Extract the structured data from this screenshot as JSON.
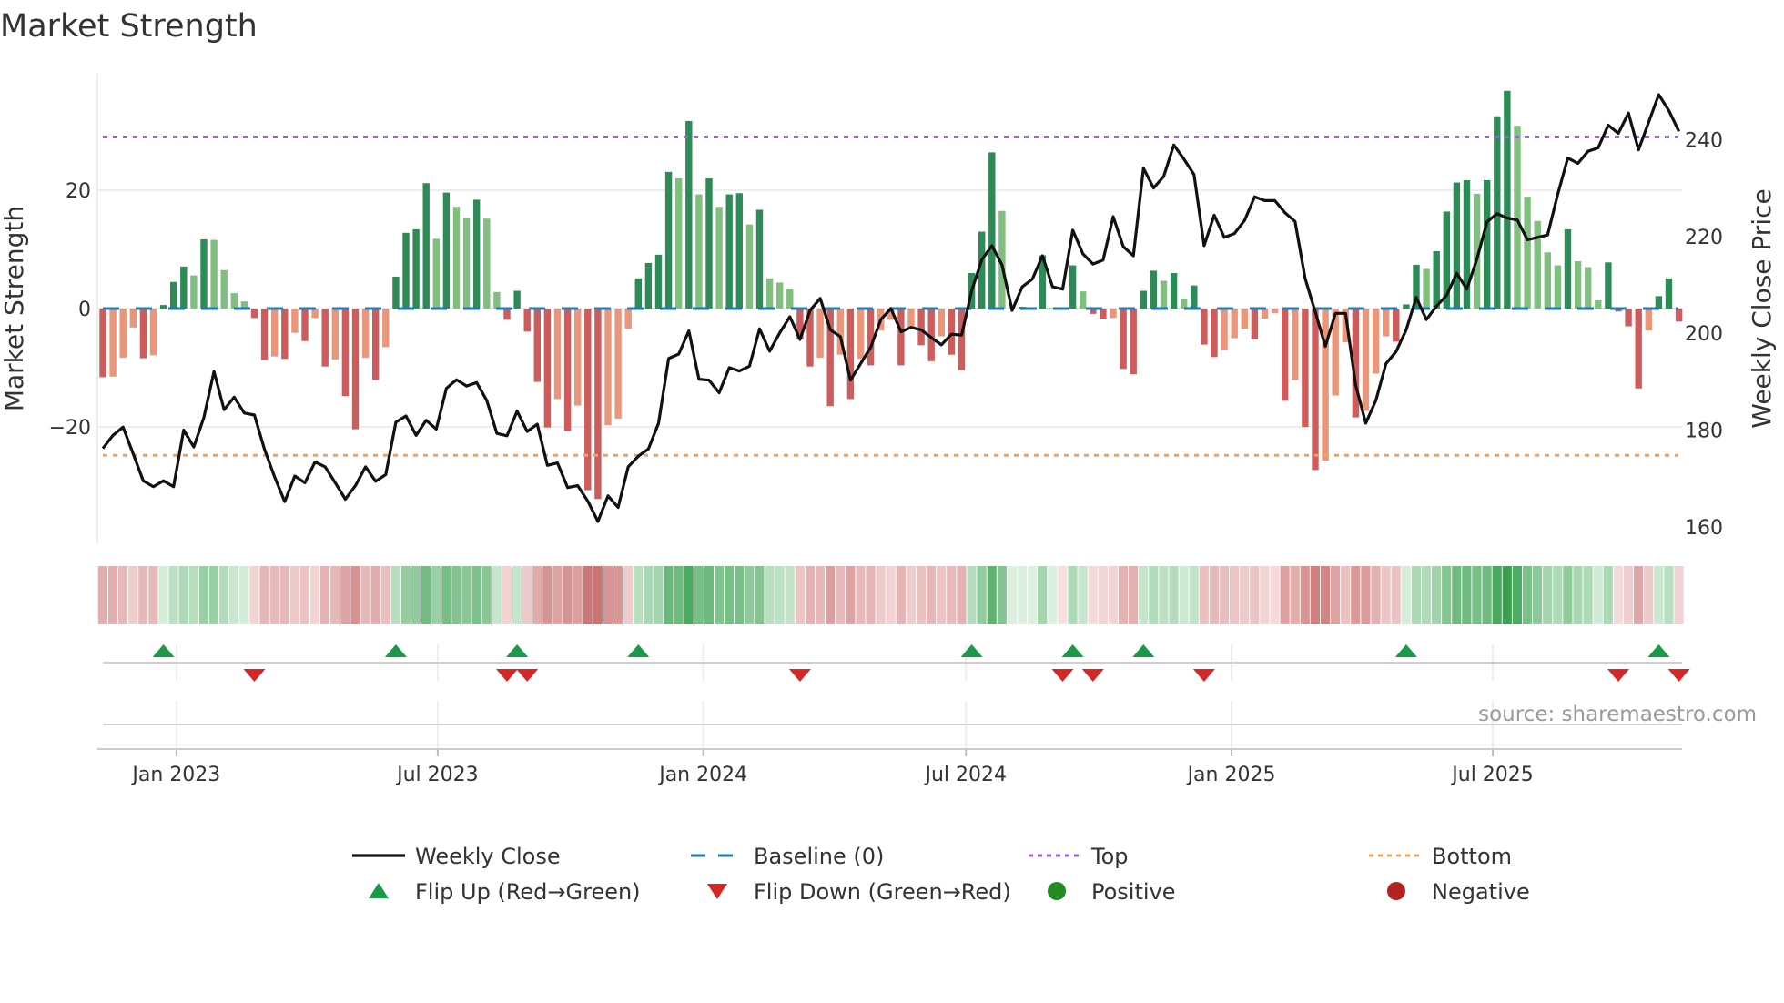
{
  "title": "Market Strength",
  "source_note": "source: sharemaestro.com",
  "colors": {
    "bar_green_dark": "#2e8b57",
    "bar_green_light": "#80bf80",
    "bar_red_dark": "#cd5c5c",
    "bar_red_light": "#e9967a",
    "price_line": "#111111",
    "baseline": "#1f77b4",
    "top": "#9b5fd6",
    "bottom": "#f0a35e",
    "flip_up": "#1a9a46",
    "flip_down": "#d62728",
    "positive": "#228b22",
    "negative": "#b22222"
  },
  "chart_data": {
    "type": "bar",
    "title": "Market Strength",
    "x_start": "2022-11-11",
    "x_step_days": 7,
    "x_ticks": [
      {
        "date": "2023-01-01",
        "label": "Jan 2023"
      },
      {
        "date": "2023-07-01",
        "label": "Jul 2023"
      },
      {
        "date": "2024-01-01",
        "label": "Jan 2024"
      },
      {
        "date": "2024-07-01",
        "label": "Jul 2024"
      },
      {
        "date": "2025-01-01",
        "label": "Jan 2025"
      },
      {
        "date": "2025-07-01",
        "label": "Jul 2025"
      }
    ],
    "ylabel_left": "Market Strength",
    "ylim_left": [
      -40,
      40
    ],
    "yticks_left": [
      {
        "v": 20,
        "label": "20"
      },
      {
        "v": 0,
        "label": "0"
      },
      {
        "v": -20,
        "label": "−20"
      }
    ],
    "ylabel_right": "Weekly Close Price",
    "ylim_right": [
      156.2,
      254
    ],
    "yticks_right": [
      {
        "v": 240,
        "label": "240"
      },
      {
        "v": 220,
        "label": "220"
      },
      {
        "v": 200,
        "label": "200"
      },
      {
        "v": 180,
        "label": "180"
      },
      {
        "v": 160,
        "label": "160"
      }
    ],
    "top_level": 29,
    "bottom_level": -24.8,
    "baseline": 0,
    "grid": true,
    "legend_position": "bottom",
    "series": [
      {
        "name": "Market Strength",
        "type": "bar",
        "values": [
          -11.6,
          -11.5,
          -8.3,
          -3.2,
          -8.4,
          -7.9,
          0.6,
          4.5,
          7.1,
          5.6,
          11.7,
          11.6,
          6.5,
          2.6,
          1.2,
          -1.6,
          -8.7,
          -8.1,
          -8.5,
          -4.1,
          -5.5,
          -1.6,
          -9.8,
          -8.6,
          -14.8,
          -20.4,
          -8.3,
          -12.1,
          -6.5,
          5.4,
          12.8,
          13.4,
          21.2,
          11.8,
          19.6,
          17.2,
          15.3,
          18.4,
          15.2,
          2.8,
          -1.9,
          3.0,
          -3.9,
          -12.4,
          -20.1,
          -15.3,
          -20.7,
          -16.4,
          -30.7,
          -32.2,
          -19.7,
          -18.6,
          -3.4,
          5.1,
          7.7,
          9.1,
          23.1,
          22.0,
          31.7,
          19.3,
          22.0,
          17.2,
          19.3,
          19.5,
          14.2,
          16.7,
          5.1,
          4.4,
          3.4,
          -5.2,
          -9.8,
          -8.3,
          -16.5,
          -7.8,
          -15.3,
          -8.5,
          -9.6,
          -3.7,
          -1.9,
          -9.6,
          -3.1,
          -6.2,
          -8.9,
          -4.7,
          -7.8,
          -10.4,
          6.0,
          13.0,
          26.4,
          16.5,
          0.1,
          0.3,
          0.1,
          9.0,
          0.1,
          -0.1,
          7.3,
          2.9,
          -0.9,
          -1.7,
          -1.6,
          -10.2,
          -11.1,
          3.0,
          6.4,
          4.7,
          6.0,
          1.7,
          3.9,
          -6.1,
          -8.2,
          -7.0,
          -5.0,
          -3.4,
          -5.2,
          -1.7,
          -0.8,
          -15.6,
          -12.1,
          -20.0,
          -27.3,
          -25.7,
          -14.7,
          -5.7,
          -18.4,
          -17.3,
          -11.0,
          -4.7,
          -5.6,
          0.7,
          7.4,
          6.7,
          9.7,
          16.4,
          21.3,
          21.7,
          19.4,
          21.7,
          32.5,
          36.8,
          30.9,
          18.9,
          14.8,
          9.5,
          7.3,
          13.4,
          8.0,
          7.0,
          1.4,
          7.8,
          -0.5,
          -3.0,
          -13.5,
          -3.7,
          2.1,
          5.1,
          -2.2
        ]
      },
      {
        "name": "Weekly Close",
        "type": "line",
        "axis": "right",
        "values": [
          176.2,
          178.9,
          180.6,
          175.1,
          169.5,
          168.3,
          169.5,
          168.3,
          180.0,
          176.5,
          182.6,
          192.1,
          184.2,
          186.8,
          183.5,
          183.1,
          176.0,
          170.3,
          165.2,
          170.5,
          169.1,
          173.4,
          172.4,
          169.1,
          165.7,
          168.5,
          172.4,
          169.4,
          170.8,
          181.6,
          182.9,
          178.9,
          182.0,
          180.2,
          188.6,
          190.4,
          189.1,
          189.8,
          186.1,
          179.3,
          178.8,
          183.9,
          179.7,
          181.2,
          172.7,
          173.2,
          168.1,
          168.5,
          165.3,
          161.1,
          166.4,
          164.0,
          172.4,
          174.6,
          176.1,
          181.4,
          194.8,
          195.7,
          200.5,
          190.5,
          190.3,
          187.7,
          192.9,
          192.2,
          193.2,
          200.9,
          196.3,
          200.1,
          203.4,
          198.7,
          204.7,
          207.2,
          200.7,
          199.3,
          190.3,
          193.7,
          197.1,
          202.8,
          205.1,
          200.3,
          201.2,
          200.7,
          199.1,
          197.6,
          199.8,
          199.6,
          208.8,
          215.2,
          218.1,
          214.1,
          204.7,
          209.6,
          211.2,
          216.0,
          209.6,
          209.1,
          221.3,
          216.4,
          214.3,
          215.1,
          224.1,
          217.9,
          216.0,
          234.1,
          230.0,
          232.4,
          238.9,
          236.0,
          232.8,
          218.1,
          224.4,
          219.8,
          220.6,
          223.3,
          228.2,
          227.4,
          227.4,
          224.9,
          223.1,
          211.3,
          204.4,
          197.3,
          204.1,
          204.1,
          189.3,
          181.4,
          186.1,
          193.7,
          196.2,
          200.7,
          207.4,
          202.8,
          205.6,
          207.8,
          212.4,
          209.1,
          215.3,
          223.0,
          224.7,
          223.8,
          223.4,
          219.3,
          219.8,
          220.3,
          228.7,
          236.2,
          235.1,
          237.6,
          238.3,
          243.0,
          241.3,
          245.5,
          237.9,
          243.6,
          249.3,
          246.0,
          241.7
        ]
      }
    ],
    "legend": [
      {
        "key": "weekly_close",
        "label": "Weekly Close"
      },
      {
        "key": "baseline",
        "label": "Baseline (0)"
      },
      {
        "key": "top",
        "label": "Top"
      },
      {
        "key": "bottom",
        "label": "Bottom"
      },
      {
        "key": "flip_up",
        "label": "Flip Up (Red→Green)"
      },
      {
        "key": "flip_down",
        "label": "Flip Down (Green→Red)"
      },
      {
        "key": "positive",
        "label": "Positive"
      },
      {
        "key": "negative",
        "label": "Negative"
      }
    ]
  }
}
